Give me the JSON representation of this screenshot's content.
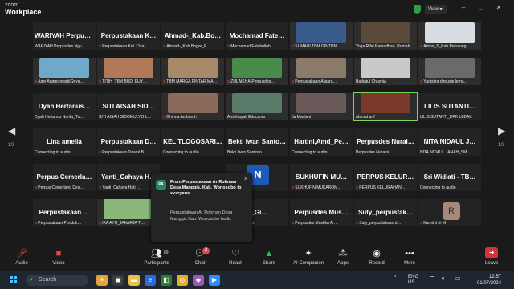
{
  "titlebar": {
    "app_line1": "zoom",
    "app_line2": "Workplace",
    "view_label": "View",
    "minimize": "–",
    "maximize": "□",
    "close": "✕"
  },
  "pagination": {
    "left_page": "1/3",
    "right_page": "1/3"
  },
  "participants_grid": [
    [
      {
        "big": "WARIYAH Perpus…",
        "tag": "WARIYAH Perpusdes Ngu…",
        "muted": false
      },
      {
        "big": "Perpustakaan K…",
        "tag": "Perpustakaan Kel. Cisa…",
        "muted": true
      },
      {
        "big": "Ahmad-_Kab.Bo…",
        "tag": "Ahmad-_Kab.Bogor_P…",
        "muted": true
      },
      {
        "big": "Mochamad Fate…",
        "tag": "Mochamad Fatehulloh",
        "muted": true
      },
      {
        "video": true,
        "img_color": "#3b5a8c",
        "tag": "SUMADI TBM GINTUN…",
        "muted": true
      },
      {
        "video": true,
        "img_color": "#5a4a3a",
        "tag": "Yoga Rifai Ramadhan, Rumah…",
        "muted": false
      },
      {
        "video": true,
        "img_color": "#d8dde4",
        "tag": "Anton_S_Kab.Pekalong…",
        "muted": true
      }
    ],
    [
      {
        "video": true,
        "img_color": "#6fa9c9",
        "tag": "Amy Anggorowati/Griya…",
        "muted": true
      },
      {
        "video": true,
        "img_color": "#b07a5a",
        "tag": "TITIH_TBM BUDI EUY…",
        "muted": true
      },
      {
        "video": true,
        "img_color": "#a88a6a",
        "tag": "TBM MARGA PINTAR MA…",
        "muted": true
      },
      {
        "video": true,
        "img_color": "#4a8a4a",
        "tag": "ZULAIKHA-Perpusdes…",
        "muted": true
      },
      {
        "video": true,
        "img_color": "#8a7a6a",
        "tag": "Perpustakaan Alisara…",
        "muted": true
      },
      {
        "video": true,
        "img_color": "#c9c9c9",
        "tag": "Badiatul Chusnia",
        "muted": false
      },
      {
        "video": true,
        "img_color": "#6a6a6a",
        "tag": "Yudistira dirpusip lema…",
        "muted": true
      }
    ],
    [
      {
        "big": "Dyah Hertanus…",
        "tag": "Dyah Hertanus Nurita_Tu…",
        "muted": false
      },
      {
        "big": "SITI AISAH SID…",
        "tag": "SITI AISAH SIDOMULYO L…",
        "muted": false
      },
      {
        "video": true,
        "img_color": "#8a6a5a",
        "tag": "Ghinna Ambaroh",
        "muted": true
      },
      {
        "video": true,
        "img_color": "#5a7a6a",
        "tag": "Aminhayati Educares",
        "muted": false
      },
      {
        "video": true,
        "img_color": "#6a5a5a",
        "tag": "Ila Marliani",
        "muted": false
      },
      {
        "video": true,
        "img_color": "#7a3a2a",
        "tag": "ahmad arif",
        "muted": false,
        "speaking": true
      },
      {
        "big": "LILIS SUTANTI…",
        "tag": "LILIS SUTANTI_DPK LEBAK",
        "muted": false
      }
    ],
    [
      {
        "big": "Lina amelia",
        "tag": "Connecting to audio",
        "muted": false
      },
      {
        "big": "Perpustakaan D…",
        "tag": "Perpustakaan Daarul B…",
        "muted": true
      },
      {
        "big": "KEL TLOGOSARI…",
        "tag": "Connecting to audio",
        "muted": false
      },
      {
        "big": "Bekti Iwan Santo…",
        "tag": "Bekti Iwan Santoso",
        "muted": false
      },
      {
        "big": "Hartini,Amd_Pe…",
        "tag": "Connecting to audio",
        "muted": false
      },
      {
        "big": "Perpusdes Nurai…",
        "tag": "Perpusdes Nuraini",
        "muted": false
      },
      {
        "big": "NITA NIDAUL J…",
        "tag": "NITA NIDAUL JANAH_SM…",
        "muted": false
      }
    ],
    [
      {
        "big": "Perpus Cemerla…",
        "tag": "Perpus Cemerlang Des…",
        "muted": true
      },
      {
        "big": "Yanti_Cahaya H…",
        "tag": "Yanti_Cahaya Hati_…",
        "muted": true
      },
      {
        "hidden": true
      },
      {
        "avatar_n": "N",
        "tag": "",
        "muted": false
      },
      {
        "big": "SUKHUFIN MU…",
        "tag": "SUKHUFIN MUKAROM…",
        "muted": true
      },
      {
        "big": "PERPUS KELUR…",
        "tag": "PERPUS KELURAHAN…",
        "muted": true
      },
      {
        "big": "Sri Widiati - TB…",
        "tag": "Connecting to audio",
        "muted": false
      }
    ],
    [
      {
        "big": "Perpustakaan …",
        "tag": "Perpustakaan Pondok…",
        "muted": true
      },
      {
        "video": true,
        "img_color": "#8ab87a",
        "tag": "IKA AYU_JAKARTA T…",
        "muted": true
      },
      {
        "hidden": true
      },
      {
        "big": "R_Gi…",
        "tag": "R_Giwangan",
        "muted": true
      },
      {
        "big": "Perpusdes Mus…",
        "tag": "Perpusdes Mustika Ar…",
        "muted": true
      },
      {
        "big": "Suty_perpustak…",
        "tag": "Suty_perpustakaan d…",
        "muted": true
      },
      {
        "avatar_r": "R",
        "tag": "Kamtini tri M",
        "muted": true
      }
    ]
  ],
  "chat_popup": {
    "avatar": "PA",
    "header": "From Perpustakaan Ar Rohman Desa Manggis, Kab. Wonosobo to everyone",
    "message": "Perpustakaan Ar Rohman Desa Manggis Kab. Wonosobo hadir.",
    "close": "✕"
  },
  "toolbar": {
    "audio": "Audio",
    "video": "Video",
    "participants": "Participants",
    "participants_count": "89",
    "chat": "Chat",
    "chat_badge": "2",
    "react": "React",
    "share": "Share",
    "ai_companion": "AI Companion",
    "apps": "Apps",
    "record": "Record",
    "more": "More",
    "leave": "Leave"
  },
  "taskbar": {
    "search_placeholder": "Search",
    "lang1": "ENG",
    "lang2": "US",
    "time": "12:57",
    "date": "01/07/2024"
  },
  "colors": {
    "mute": "#e5484d",
    "leave": "#d4333a",
    "speaking": "#7fd35a",
    "taskbar": "#1f2630"
  }
}
